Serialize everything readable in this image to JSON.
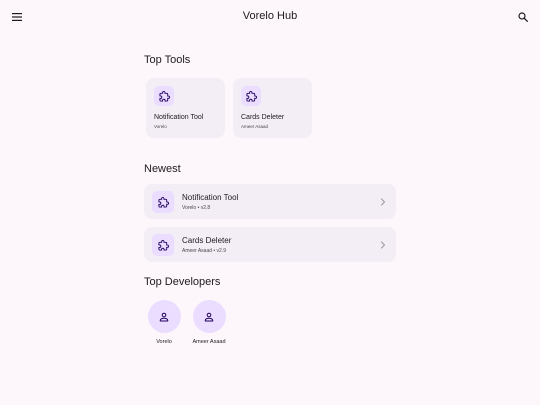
{
  "app": {
    "title": "Vorelo Hub"
  },
  "icons": {
    "menu": "menu-icon",
    "search": "search-icon",
    "tool": "puzzle-icon",
    "chevron": "chevron-right-icon",
    "developer": "person-icon"
  },
  "colors": {
    "background": "#fdf7fc",
    "card": "#f3edf5",
    "icon_tile": "#eaddff",
    "icon": "#21005d"
  },
  "sections": {
    "top_tools": "Top Tools",
    "newest": "Newest",
    "top_developers": "Top Developers"
  },
  "top_tools": [
    {
      "name": "Notification Tool",
      "developer": "Vorelo"
    },
    {
      "name": "Cards Deleter",
      "developer": "Ameer Asaad"
    }
  ],
  "newest": [
    {
      "name": "Notification Tool",
      "meta": "Vorelo • v2.8"
    },
    {
      "name": "Cards Deleter",
      "meta": "Ameer Asaad • v2.9"
    }
  ],
  "top_developers": [
    {
      "name": "Vorelo"
    },
    {
      "name": "Ameer Asaad"
    }
  ]
}
